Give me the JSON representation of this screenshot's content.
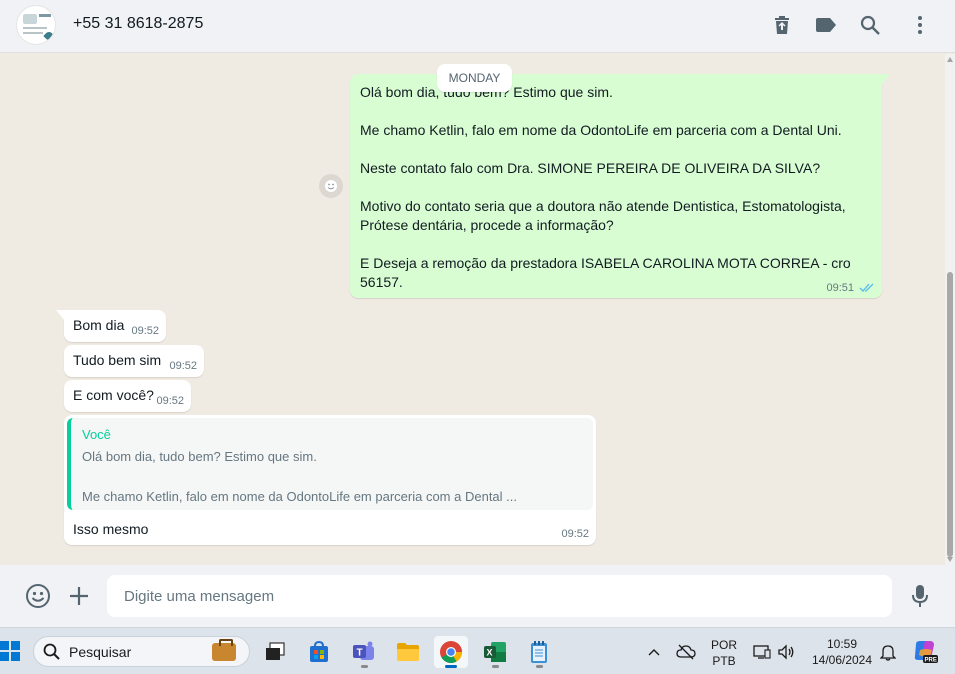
{
  "header": {
    "contact_name": "+55 31 8618-2875",
    "icons": [
      "delete-icon",
      "label-icon",
      "search-icon",
      "menu-icon"
    ]
  },
  "chat": {
    "day_label": "MONDAY",
    "outgoing": {
      "text": "Olá bom dia, tudo bem? Estimo que sim.\n\nMe chamo Ketlin, falo em nome da OdontoLife em parceria com a Dental Uni.\n\nNeste contato falo com Dra. SIMONE PEREIRA DE OLIVEIRA DA SILVA?\n\nMotivo do contato seria que a doutora não atende Dentistica, Estomatologista, Prótese dentária, procede a informação?\n\nE Deseja a remoção da prestadora ISABELA CAROLINA MOTA CORREA - cro 56157.",
      "time": "09:51",
      "status": "read"
    },
    "incoming": [
      {
        "text": "Bom dia",
        "time": "09:52"
      },
      {
        "text": "Tudo bem sim",
        "time": "09:52"
      },
      {
        "text": "E com você?",
        "time": "09:52"
      }
    ],
    "reply": {
      "quote_author": "Você",
      "quote_line1": "Olá bom dia, tudo bem? Estimo que sim.",
      "quote_line2": "Me chamo Ketlin, falo em nome da OdontoLife em parceria com a Dental ...",
      "text": "Isso mesmo",
      "time": "09:52"
    }
  },
  "composer": {
    "placeholder": "Digite uma mensagem"
  },
  "taskbar": {
    "search_label": "Pesquisar",
    "lang_top": "POR",
    "lang_bottom": "PTB",
    "time": "10:59",
    "date": "14/06/2024"
  },
  "colors": {
    "outgoing_bubble": "#d9fdd3",
    "incoming_bubble": "#ffffff",
    "chat_bg": "#efeae2",
    "accent": "#06cf9c",
    "read_ticks": "#53bdeb"
  }
}
